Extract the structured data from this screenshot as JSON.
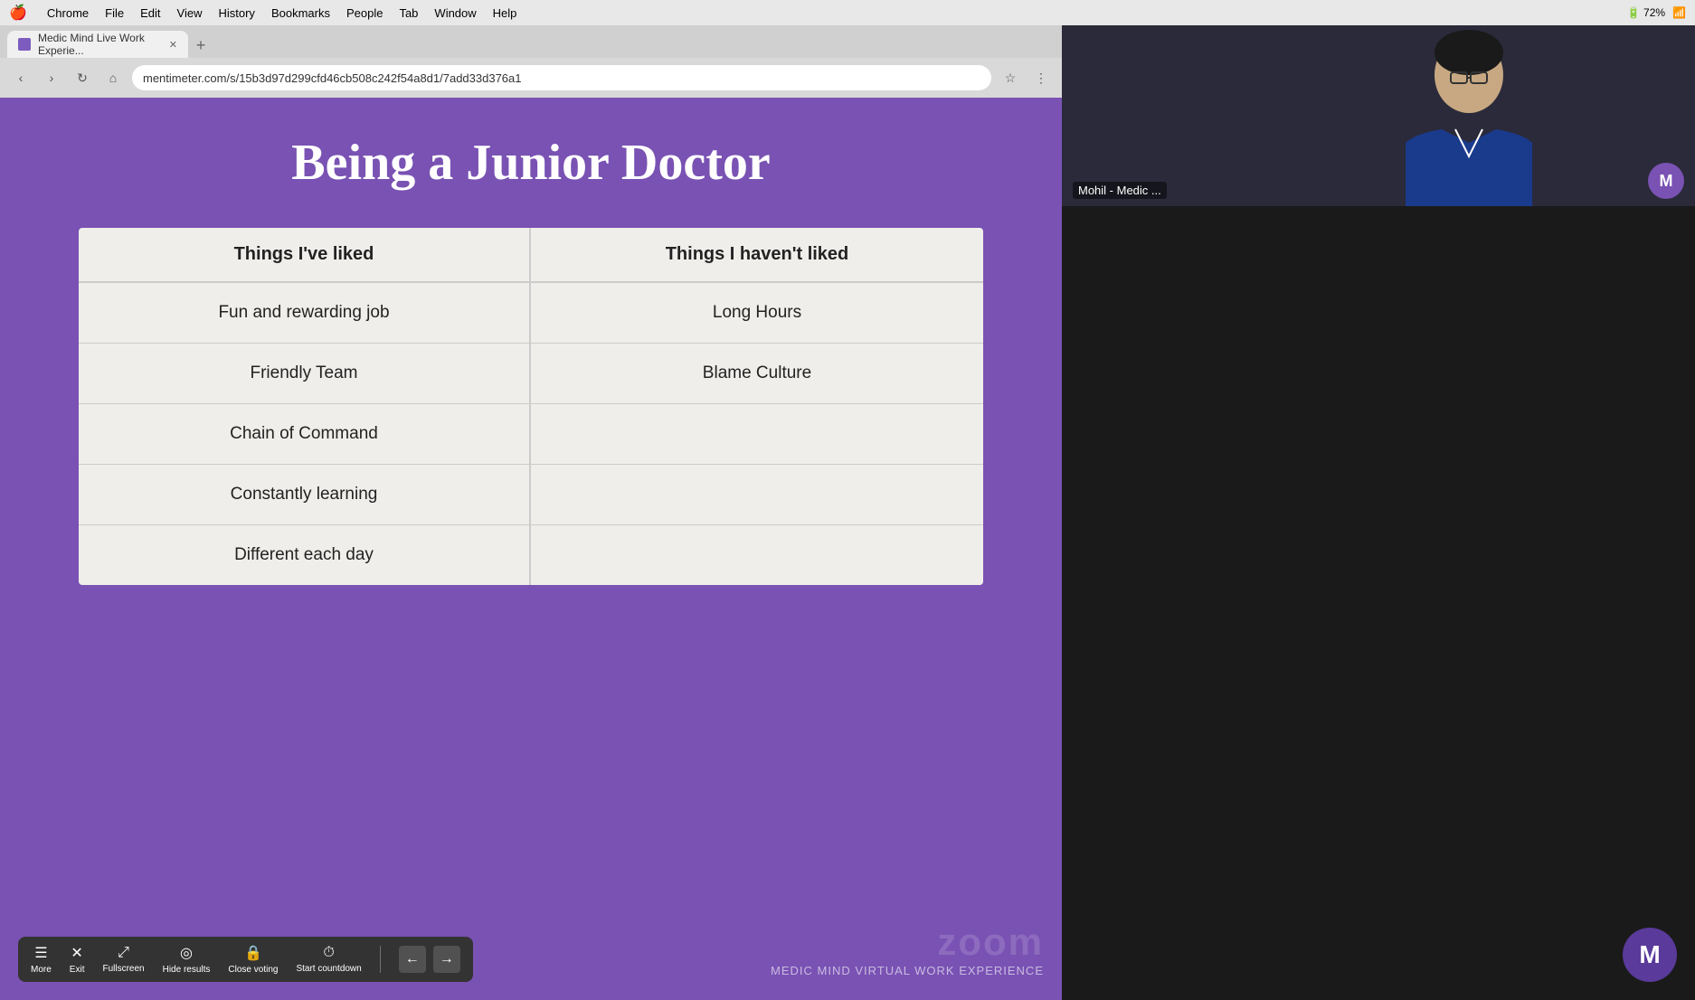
{
  "menubar": {
    "apple": "🍎",
    "items": [
      "Chrome",
      "File",
      "Edit",
      "View",
      "History",
      "Bookmarks",
      "People",
      "Tab",
      "Window",
      "Help"
    ],
    "right": [
      "72%",
      "●●●"
    ]
  },
  "browser": {
    "tab_title": "Medic Mind Live Work Experie...",
    "url": "mentimeter.com/s/15b3d97d299cfd46cb508c242f54a8d1/7add33d376a1"
  },
  "slide": {
    "title": "Being a Junior Doctor",
    "col_liked": "Things I've liked",
    "col_not_liked": "Things I haven't liked",
    "liked_items": [
      "Fun and rewarding job",
      "Friendly Team",
      "Chain of Command",
      "Constantly learning",
      "Different each day"
    ],
    "not_liked_items": [
      "Long Hours",
      "Blame Culture",
      "",
      "",
      ""
    ]
  },
  "toolbar": {
    "items": [
      {
        "icon": "☰",
        "label": "More"
      },
      {
        "icon": "✕",
        "label": "Exit"
      },
      {
        "icon": "⤢",
        "label": "Fullscreen"
      },
      {
        "icon": "◎",
        "label": "Hide results"
      },
      {
        "icon": "🔒",
        "label": "Close voting"
      },
      {
        "icon": "⏱",
        "label": "Start countdown"
      }
    ],
    "nav_prev": "←",
    "nav_next": "→"
  },
  "branding": {
    "zoom": "zoom",
    "medic_mind": "MEDIC MIND VIRTUAL WORK EXPERIENCE"
  },
  "video": {
    "label": "Mohil - Medic ...",
    "avatar_letter": "M"
  }
}
